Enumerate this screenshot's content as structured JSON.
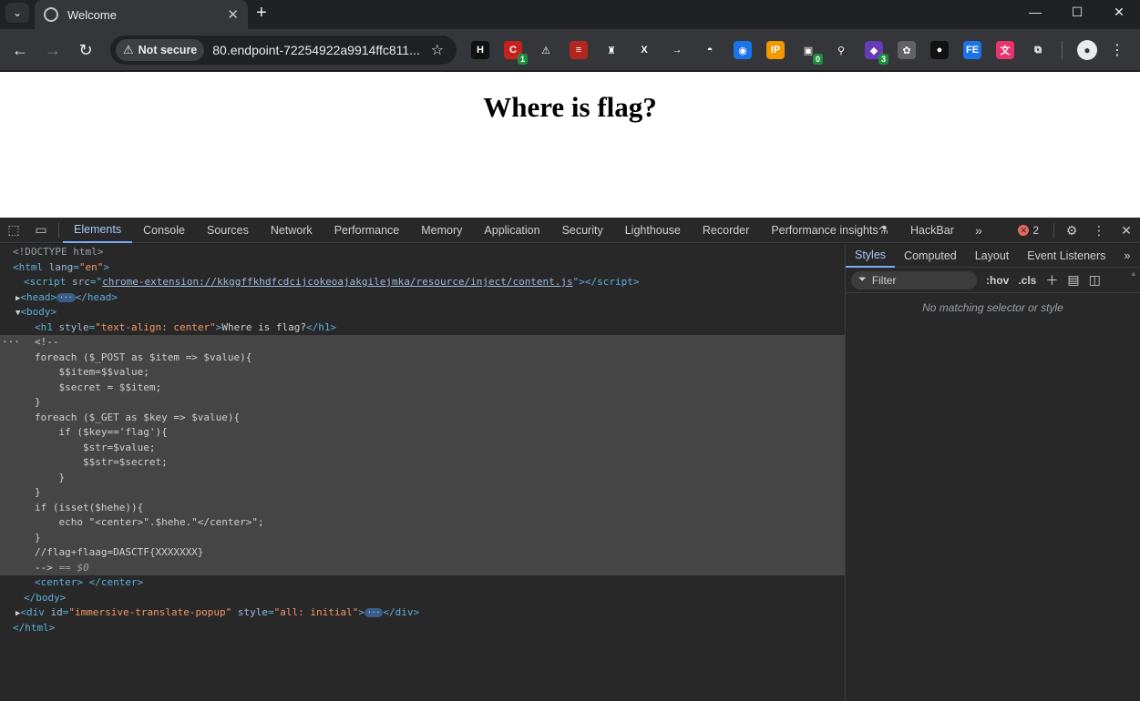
{
  "browser": {
    "tab_title": "Welcome",
    "security_label": "Not secure",
    "url": "80.endpoint-72254922a9914ffc811...",
    "extensions": [
      {
        "name": "ext-h",
        "glyph": "H",
        "color": "#111111"
      },
      {
        "name": "ext-red-c",
        "glyph": "C",
        "color": "#c5221f",
        "badge": "1"
      },
      {
        "name": "ext-warning",
        "glyph": "⚠",
        "color": "#35363a"
      },
      {
        "name": "ext-flag",
        "glyph": "≡",
        "color": "#b3261e"
      },
      {
        "name": "ext-wappalyzer",
        "glyph": "♜",
        "color": "#35363a"
      },
      {
        "name": "ext-x",
        "glyph": "X",
        "color": "#35363a"
      },
      {
        "name": "ext-arrow",
        "glyph": "→",
        "color": "#35363a"
      },
      {
        "name": "ext-hat",
        "glyph": "◓",
        "color": "#35363a"
      },
      {
        "name": "ext-eye",
        "glyph": "◉",
        "color": "#1a73e8"
      },
      {
        "name": "ext-ip",
        "glyph": "IP",
        "color": "#f29900"
      },
      {
        "name": "ext-capture",
        "glyph": "▣",
        "color": "#35363a",
        "badge": "0"
      },
      {
        "name": "ext-search",
        "glyph": "⚲",
        "color": "#35363a"
      },
      {
        "name": "ext-purple",
        "glyph": "◆",
        "color": "#673ab7",
        "badge": "3"
      },
      {
        "name": "ext-gray",
        "glyph": "✿",
        "color": "#5f6368"
      },
      {
        "name": "ext-ring",
        "glyph": "●",
        "color": "#111111"
      },
      {
        "name": "ext-fe",
        "glyph": "FE",
        "color": "#1a73e8"
      },
      {
        "name": "ext-translate",
        "glyph": "文",
        "color": "#e8336d"
      },
      {
        "name": "ext-puzzle",
        "glyph": "⧉",
        "color": "#35363a"
      }
    ]
  },
  "page": {
    "heading": "Where is flag?"
  },
  "devtools": {
    "tabs": [
      "Elements",
      "Console",
      "Sources",
      "Network",
      "Performance",
      "Memory",
      "Application",
      "Security",
      "Lighthouse",
      "Recorder",
      "Performance insights",
      "HackBar"
    ],
    "error_count": "2",
    "dom": {
      "doctype": "<!DOCTYPE html>",
      "html_open": "<html",
      "html_lang_attr": "lang",
      "html_lang_val": "\"en\"",
      "script_tag": "<script",
      "script_src_attr": "src",
      "script_src": "chrome-extension://kkggffkhdfcdcijcokeoajakgilejmka/resource/inject/content.js",
      "head_open": "<head>",
      "head_close": "</head>",
      "body_open": "<body>",
      "h1_open": "<h1",
      "h1_style_attr": "style",
      "h1_style_val": "\"text-align: center\"",
      "h1_text": "Where is flag?",
      "h1_close": "</h1>",
      "comment_lines": [
        "<!--",
        "foreach ($_POST as $item => $value){",
        "    $$item=$$value;",
        "    $secret = $$item;",
        "}",
        "foreach ($_GET as $key => $value){",
        "    if ($key=='flag'){",
        "        $str=$value;",
        "        $$str=$secret;",
        "    }",
        "}",
        "if (isset($hehe)){",
        "    echo \"<center>\".$hehe.\"</center>\";",
        "}",
        "//flag+flaag=DASCTF{XXXXXXX}",
        "-->"
      ],
      "selected_marker": "== $0",
      "center_open": "<center>",
      "center_close": "</center>",
      "body_close": "</body>",
      "div_open": "<div",
      "div_id_attr": "id",
      "div_id_val": "\"immersive-translate-popup\"",
      "div_style_attr": "style",
      "div_style_val": "\"all: initial\"",
      "div_close": "</div>",
      "html_close": "</html>"
    },
    "styles_tabs": [
      "Styles",
      "Computed",
      "Layout",
      "Event Listeners"
    ],
    "filter_placeholder": "Filter",
    "hov_label": ":hov",
    "cls_label": ".cls",
    "empty_message": "No matching selector or style"
  }
}
